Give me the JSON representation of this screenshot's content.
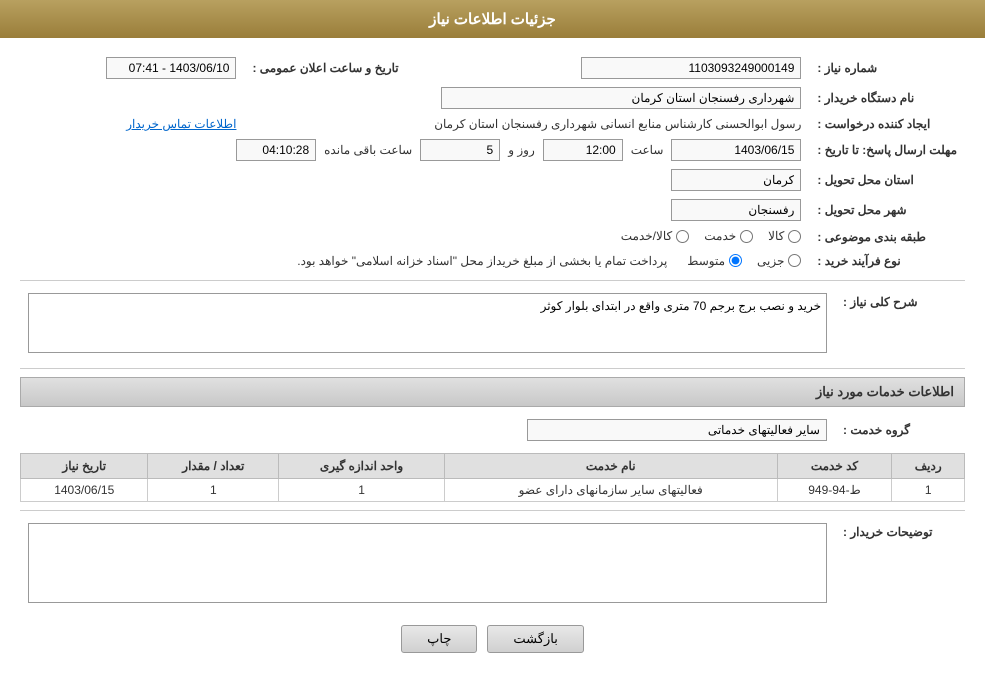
{
  "header": {
    "title": "جزئیات اطلاعات نیاز"
  },
  "fields": {
    "reference_number_label": "شماره نیاز :",
    "reference_number_value": "1103093249000149",
    "buyer_org_label": "نام دستگاه خریدار :",
    "buyer_org_value": "شهرداری رفسنجان استان کرمان",
    "creator_label": "ایجاد کننده درخواست :",
    "creator_value": "رسول ابوالحسنی کارشناس منابع انسانی شهرداری رفسنجان استان کرمان",
    "contact_link": "اطلاعات تماس خریدار",
    "announce_datetime_label": "تاریخ و ساعت اعلان عمومی :",
    "announce_datetime_value": "1403/06/10 - 07:41",
    "reply_deadline_label": "مهلت ارسال پاسخ: تا تاریخ :",
    "reply_date": "1403/06/15",
    "reply_time": "12:00",
    "reply_days": "5",
    "reply_remaining": "04:10:28",
    "reply_days_label": "روز و",
    "reply_time_label": "ساعت",
    "reply_remaining_label": "ساعت باقی مانده",
    "delivery_province_label": "استان محل تحویل :",
    "delivery_province_value": "کرمان",
    "delivery_city_label": "شهر محل تحویل :",
    "delivery_city_value": "رفسنجان",
    "category_label": "طبقه بندی موضوعی :",
    "category_kala": "کالا",
    "category_khadamat": "خدمت",
    "category_kala_khadamat": "کالا/خدمت",
    "process_label": "نوع فرآیند خرید :",
    "process_jozi": "جزیی",
    "process_mottaset": "متوسط",
    "process_notice": "پرداخت تمام یا بخشی از مبلغ خریداز محل \"اسناد خزانه اسلامی\" خواهد بود.",
    "description_section_title": "شرح کلی نیاز :",
    "description_value": "خرید و نصب برج برجم 70 متری واقع در ابتدای بلوار کوثر",
    "services_section_title": "اطلاعات خدمات مورد نیاز",
    "service_group_label": "گروه خدمت :",
    "service_group_value": "سایر فعالیتهای خدماتی",
    "table": {
      "headers": [
        "ردیف",
        "کد خدمت",
        "نام خدمت",
        "واحد اندازه گیری",
        "تعداد / مقدار",
        "تاریخ نیاز"
      ],
      "rows": [
        {
          "row": "1",
          "code": "ط-94-949",
          "name": "فعالیتهای سایر سازمانهای دارای عضو",
          "unit": "1",
          "quantity": "1",
          "date": "1403/06/15"
        }
      ]
    },
    "buyer_notes_label": "توضیحات خریدار :",
    "buyer_notes_value": ""
  },
  "buttons": {
    "print": "چاپ",
    "back": "بازگشت"
  }
}
